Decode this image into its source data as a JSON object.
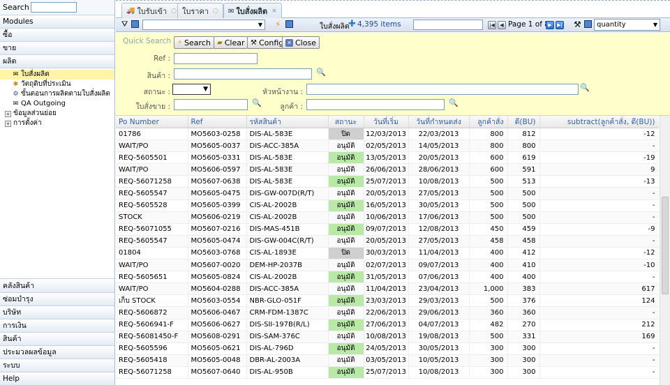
{
  "sidebar": {
    "search_label": "Search",
    "search_value": "",
    "modules_label": "Modules",
    "top_menus": [
      "ซื้อ",
      "ขาย",
      "ผลิต"
    ],
    "tree": [
      {
        "label": "ใบสั่งผลิต",
        "icon": "envelope-icon",
        "selected": true
      },
      {
        "label": "วัตถุดิบที่ประเมิน",
        "icon": "star-icon",
        "selected": false
      },
      {
        "label": "ขั้นตอนการผลิตตามใบสั่งผลิต",
        "icon": "gears-icon",
        "selected": false
      },
      {
        "label": "QA Outgoing",
        "icon": "envelope-icon",
        "selected": false
      },
      {
        "label": "ข้อมูลส่วนย่อย",
        "icon": "expand-icon",
        "selected": false
      },
      {
        "label": "การตั้งค่า",
        "icon": "expand-icon",
        "selected": false
      }
    ],
    "bottom_menus": [
      "คลังสินค้า",
      "ซ่อมบำรุง",
      "บริษัท",
      "การเงิน",
      "สินค้า",
      "ประมวลผลข้อมูล",
      "ระบบ",
      "Help"
    ]
  },
  "tabs": [
    {
      "label": "ใบรับเข้า",
      "active": false
    },
    {
      "label": "ใบราคา",
      "active": false
    },
    {
      "label": "ใบสั่งผลิต",
      "active": true
    }
  ],
  "toolbar": {
    "filter_value": "",
    "title": "ใบสั่งผลิต",
    "count": "4,395 items",
    "page_search_value": "",
    "page_label": "Page 1 of 88",
    "column_select": "quantity"
  },
  "quick_search": {
    "title": "Quick Search :",
    "buttons": {
      "search": "Search",
      "clear": "Clear",
      "config": "Config",
      "close": "Close"
    },
    "fields": {
      "ref": "Ref :",
      "product": "สินค้า :",
      "status": "สถานะ :",
      "header": "หัวหน้างาน :",
      "sales_order": "ใบสั่งขาย :",
      "customer": "ลูกค้า :"
    }
  },
  "grid": {
    "columns": [
      "Po Number",
      "Ref",
      "รหัสสินค้า",
      "สถานะ",
      "วันที่เริ่ม",
      "วันที่กำหนดส่ง",
      "ลูกค้าสั่ง",
      "ดี(BU)",
      "subtract(ลูกค้าสั่ง, ดี(BU))"
    ],
    "rows": [
      [
        "01786",
        "MO5603-0258",
        "DIS-AL-583E",
        "ปิด",
        "12/03/2013",
        "22/03/2013",
        "800",
        "812",
        "-12"
      ],
      [
        "WAIT/PO",
        "MO5605-0037",
        "DIS-ACC-385A",
        "อนุมัติ",
        "02/05/2013",
        "14/05/2013",
        "800",
        "800",
        "-"
      ],
      [
        "REQ-5605501",
        "MO5605-0331",
        "DIS-AL-583E",
        "อนุมัติ",
        "13/05/2013",
        "20/05/2013",
        "600",
        "619",
        "-19"
      ],
      [
        "WAIT/PO",
        "MO5606-0597",
        "DIS-AL-583E",
        "อนุมัติ",
        "26/06/2013",
        "28/06/2013",
        "600",
        "591",
        "9"
      ],
      [
        "REQ-56071258",
        "MO5607-0638",
        "DIS-AL-583E",
        "อนุมัติ",
        "25/07/2013",
        "10/08/2013",
        "500",
        "513",
        "-13"
      ],
      [
        "REQ-5605547",
        "MO5605-0475",
        "DIS-GW-007D(R/T)",
        "อนุมัติ",
        "20/05/2013",
        "27/05/2013",
        "500",
        "500",
        "-"
      ],
      [
        "REQ-5605528",
        "MO5605-0399",
        "CIS-AL-2002B",
        "อนุมัติ",
        "16/05/2013",
        "30/05/2013",
        "500",
        "500",
        "-"
      ],
      [
        "STOCK",
        "MO5606-0219",
        "CIS-AL-2002B",
        "อนุมัติ",
        "10/06/2013",
        "17/06/2013",
        "500",
        "500",
        "-"
      ],
      [
        "REQ-56071055",
        "MO5607-0216",
        "DIS-MAS-451B",
        "อนุมัติ",
        "09/07/2013",
        "12/08/2013",
        "450",
        "459",
        "-9"
      ],
      [
        "REQ-5605547",
        "MO5605-0474",
        "DIS-GW-004C(R/T)",
        "อนุมัติ",
        "20/05/2013",
        "27/05/2013",
        "458",
        "458",
        "-"
      ],
      [
        "01804",
        "MO5603-0768",
        "CIS-AL-1893E",
        "ปิด",
        "30/03/2013",
        "11/04/2013",
        "400",
        "412",
        "-12"
      ],
      [
        "WAIT/PO",
        "MO5607-0020",
        "DEM-HP-2037B",
        "อนุมัติ",
        "02/07/2013",
        "09/07/2013",
        "400",
        "410",
        "-10"
      ],
      [
        "REQ-5605651",
        "MO5605-0824",
        "CIS-AL-2002B",
        "อนุมัติ",
        "31/05/2013",
        "07/06/2013",
        "400",
        "400",
        "-"
      ],
      [
        "WAIT/PO",
        "MO5604-0288",
        "DIS-ACC-385A",
        "อนุมัติ",
        "11/04/2013",
        "23/04/2013",
        "1,000",
        "383",
        "617"
      ],
      [
        "เก็บ STOCK",
        "MO5603-0554",
        "NBR-GLO-051F",
        "อนุมัติ",
        "23/03/2013",
        "29/03/2013",
        "500",
        "376",
        "124"
      ],
      [
        "REQ-5606872",
        "MO5606-0467",
        "CRM-FDM-1387C",
        "อนุมัติ",
        "22/06/2013",
        "29/06/2013",
        "360",
        "360",
        "-"
      ],
      [
        "REQ-5606941-F",
        "MO5606-0627",
        "DIS-SII-197B(R/L)",
        "อนุมัติ",
        "27/06/2013",
        "04/07/2013",
        "482",
        "270",
        "212"
      ],
      [
        "REQ-56081450-F",
        "MO5608-0291",
        "DIS-SAM-376C",
        "อนุมัติ",
        "10/08/2013",
        "19/08/2013",
        "500",
        "331",
        "169"
      ],
      [
        "REQ-5605596",
        "MO5605-0621",
        "DIS-AL-796D",
        "อนุมัติ",
        "24/05/2013",
        "30/05/2013",
        "300",
        "300",
        "-"
      ],
      [
        "REQ-5605418",
        "MO5605-0048",
        "DBR-AL-2003A",
        "อนุมัติ",
        "03/05/2013",
        "10/05/2013",
        "300",
        "300",
        "-"
      ],
      [
        "REQ-56071258",
        "MO5607-0640",
        "DIS-AL-950B",
        "อนุมัติ",
        "25/07/2013",
        "10/08/2013",
        "300",
        "300",
        "-"
      ]
    ]
  },
  "colors": {
    "accent": "#2f5fa0",
    "status_ok": "#b8e9a7",
    "status_closed": "#cfcfcf",
    "quick_search_bg": "#ffffcc",
    "selected": "#fff4a8"
  }
}
